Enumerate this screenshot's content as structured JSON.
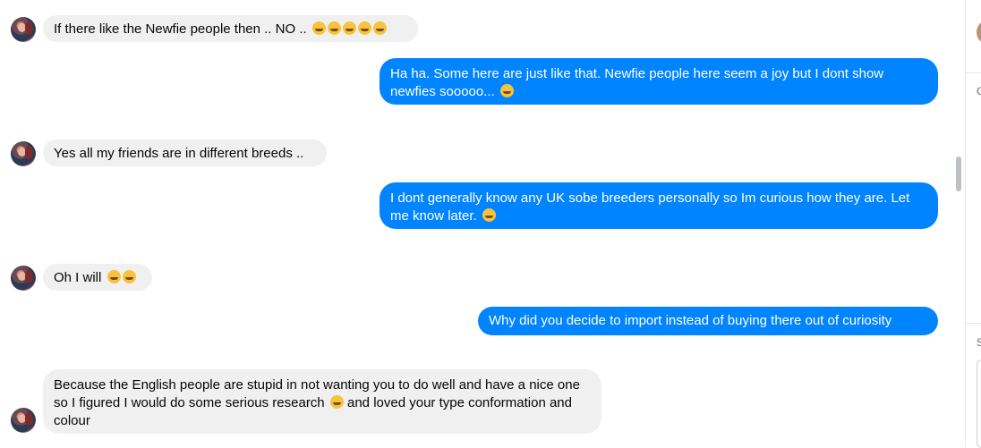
{
  "messages": [
    {
      "dir": "in",
      "text": "If there like the Newfie people then .. NO ..",
      "emoji_count": 5
    },
    {
      "dir": "out",
      "text": "Ha ha. Some here are just like that. Newfie people here seem a joy but I dont show newfies sooooo...",
      "emoji_count": 1
    },
    {
      "dir": "in",
      "text": "Yes all my friends are in different breeds ..",
      "emoji_count": 0
    },
    {
      "dir": "out",
      "text": "I dont generally know any UK sobe breeders personally so Im curious how they are. Let me know later.",
      "emoji_count": 1
    },
    {
      "dir": "in",
      "text": "Oh I will",
      "emoji_count": 2
    },
    {
      "dir": "out",
      "text": "Why did you decide to import instead of buying there out of curiosity",
      "emoji_count": 0
    },
    {
      "dir": "in",
      "text_a": "Because the English people are stupid in not wanting you to do well and have a nice one so I figured I would do some serious research",
      "text_b": "and loved your type conformation and colour",
      "emoji_count": 1
    }
  ],
  "side_panel": {
    "char1": "C",
    "char2": "S"
  },
  "colors": {
    "outgoing": "#0084ff",
    "incoming": "#f0f0f0"
  }
}
